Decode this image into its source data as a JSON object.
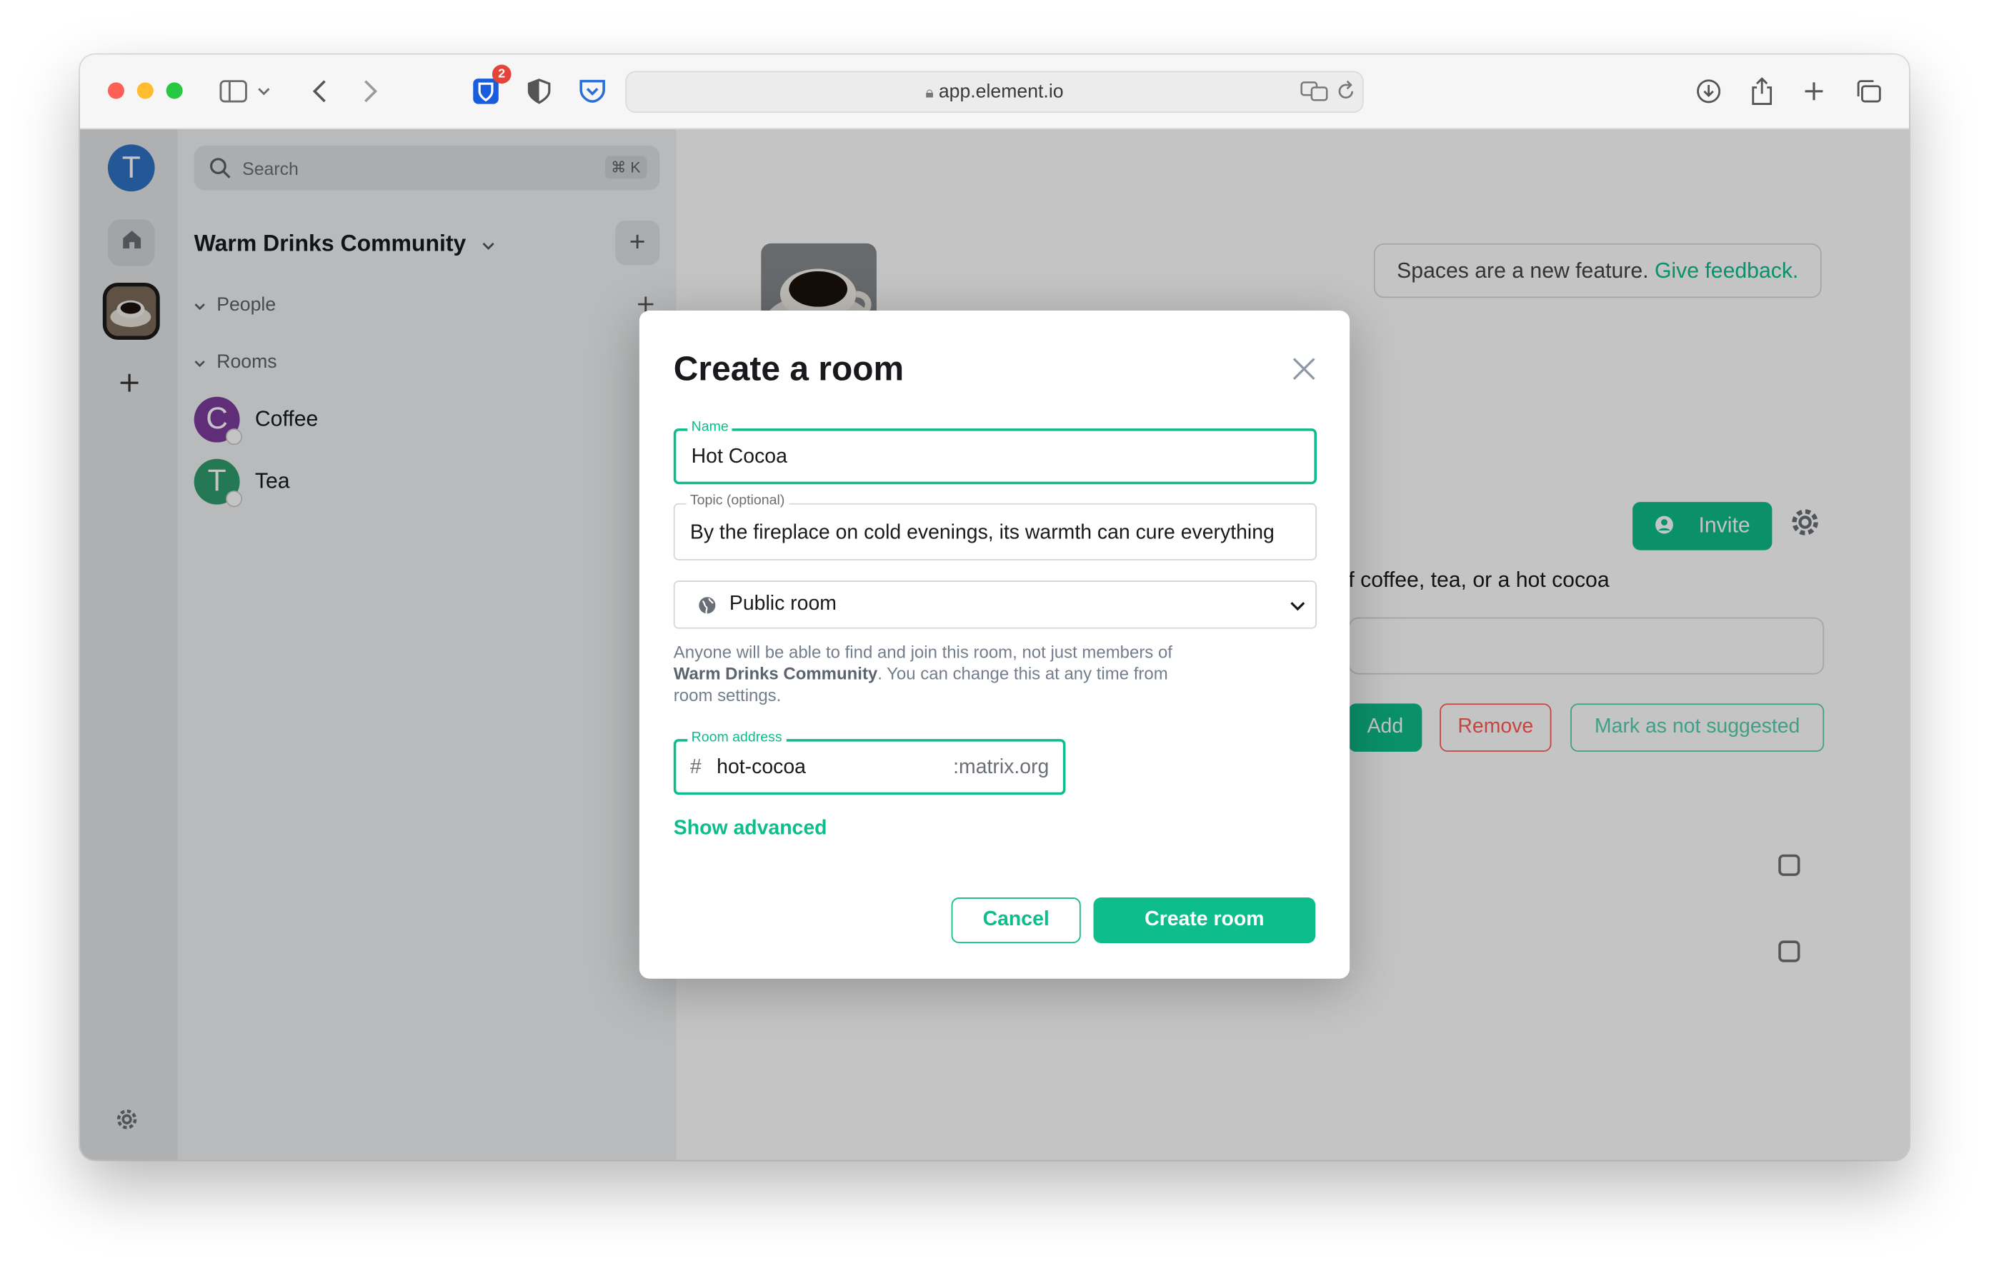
{
  "browser": {
    "url": "app.element.io",
    "extension_badge_count": "2"
  },
  "spaces": {
    "user_initial": "T",
    "add_icon": "plus-icon"
  },
  "room_list": {
    "search_placeholder": "Search",
    "search_shortcut": "⌘ K",
    "space_name": "Warm Drinks Community",
    "add_button": "+",
    "sections": {
      "people": "People",
      "rooms": "Rooms"
    },
    "rooms": [
      {
        "initial": "C",
        "name": "Coffee",
        "color": "#7e3c9e"
      },
      {
        "initial": "T",
        "name": "Tea",
        "color": "#2f9c6e"
      }
    ]
  },
  "space_home": {
    "feedback_text": "Spaces are a new feature.",
    "feedback_link": "Give feedback.",
    "invite_label": "Invite",
    "description_partial": "f coffee, tea, or a hot cocoa",
    "add_label": "Add",
    "remove_label": "Remove",
    "mark_not_suggested_label": "Mark as not suggested"
  },
  "modal": {
    "title": "Create a room",
    "name_label": "Name",
    "name_value": "Hot Cocoa",
    "topic_label": "Topic (optional)",
    "topic_value": "By the fireplace on cold evenings, its warmth can cure everything",
    "visibility_value": "Public room",
    "help_prefix": "Anyone will be able to find and join this room, not just members of ",
    "help_space": "Warm Drinks Community",
    "help_suffix": ". You can change this at any time from room settings.",
    "address_label": "Room address",
    "address_prefix": "#",
    "address_value": "hot-cocoa",
    "address_suffix": ":matrix.org",
    "show_advanced": "Show advanced",
    "cancel_label": "Cancel",
    "create_label": "Create room"
  },
  "colors": {
    "accent": "#0dbd8b",
    "danger": "#ff5b55"
  }
}
